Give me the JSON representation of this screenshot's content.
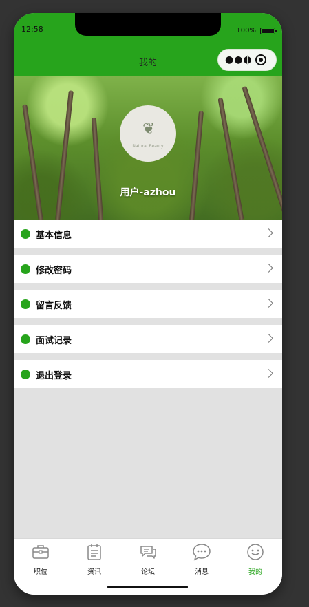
{
  "status_bar": {
    "time": "12:58",
    "battery": "100%"
  },
  "navbar": {
    "title": "我的",
    "more_icon": "more-dots-icon",
    "close_icon": "target-icon"
  },
  "profile": {
    "username": "用户-azhou",
    "avatar_caption": "Natural Beauty"
  },
  "menu": {
    "items": [
      {
        "label": "基本信息"
      },
      {
        "label": "修改密码"
      },
      {
        "label": "留言反馈"
      },
      {
        "label": "面试记录"
      },
      {
        "label": "退出登录"
      }
    ]
  },
  "tabbar": {
    "active_color": "#27a41c",
    "items": [
      {
        "label": "职位",
        "icon": "briefcase-icon"
      },
      {
        "label": "资讯",
        "icon": "clipboard-icon"
      },
      {
        "label": "论坛",
        "icon": "forum-icon"
      },
      {
        "label": "消息",
        "icon": "chat-bubble-icon"
      },
      {
        "label": "我的",
        "icon": "smiley-icon"
      }
    ]
  },
  "colors": {
    "brand": "#27a41c",
    "background": "#e1e1e1"
  }
}
